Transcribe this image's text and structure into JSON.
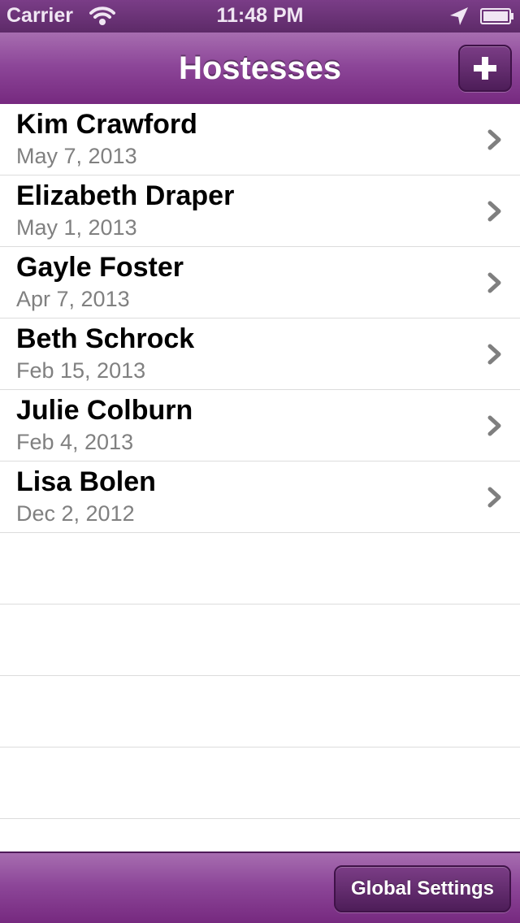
{
  "status_bar": {
    "carrier": "Carrier",
    "time": "11:48 PM",
    "wifi_icon": "wifi-icon",
    "location_icon": "location-arrow-icon",
    "battery_icon": "battery-icon"
  },
  "nav_bar": {
    "title": "Hostesses",
    "add_icon": "plus-icon"
  },
  "hostesses": [
    {
      "name": "Kim Crawford",
      "date": "May 7, 2013"
    },
    {
      "name": "Elizabeth Draper",
      "date": "May 1, 2013"
    },
    {
      "name": "Gayle Foster",
      "date": "Apr 7, 2013"
    },
    {
      "name": "Beth Schrock",
      "date": "Feb 15, 2013"
    },
    {
      "name": "Julie Colburn",
      "date": "Feb 4, 2013"
    },
    {
      "name": "Lisa Bolen",
      "date": "Dec 2, 2012"
    }
  ],
  "toolbar": {
    "settings_label": "Global Settings"
  },
  "colors": {
    "bar_purple": "#8d4799",
    "button_purple": "#5d2a68",
    "date_gray": "#808080"
  }
}
